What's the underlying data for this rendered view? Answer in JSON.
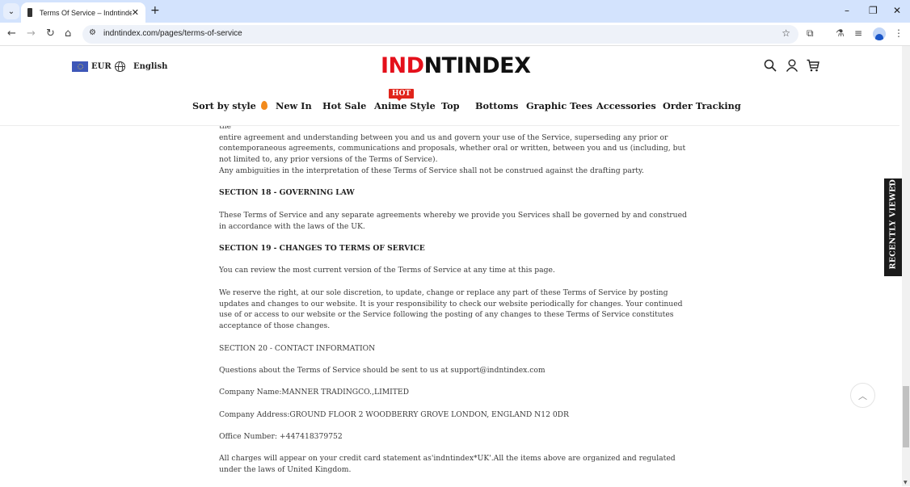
{
  "browser": {
    "tab_title": "Terms Of Service – Indntindex",
    "url": "indntindex.com/pages/terms-of-service",
    "icons": [
      "tab-search-icon",
      "back-icon",
      "forward-icon",
      "reload-icon",
      "home-icon",
      "site-settings-icon",
      "bookmark-star-icon",
      "extensions-icon",
      "labs-icon",
      "reading-list-icon",
      "profile-icon",
      "menu-icon"
    ]
  },
  "header": {
    "currency": "EUR",
    "language": "English",
    "logo_red": "IND",
    "logo_black": "NTINDEX",
    "hot_badge": "HOT",
    "nav": [
      {
        "label": "Sort by style"
      },
      {
        "label": "New In"
      },
      {
        "label": "Hot Sale"
      },
      {
        "label": "Anime Style"
      },
      {
        "label": "Top"
      },
      {
        "label": "Bottoms"
      },
      {
        "label": "Graphic Tees"
      },
      {
        "label": "Accessories"
      },
      {
        "label": "Order Tracking"
      }
    ]
  },
  "content": {
    "p0_clipped": "These Terms of Service and any policies or operating rules posted by us on this site or in respect to the Service constitutes the",
    "p0": "entire agreement and understanding between you and us and govern your use of the Service, superseding any prior or contemporaneous agreements, communications and proposals, whether oral or written, between you and us (including, but not limited to, any prior versions of the Terms of Service).",
    "p0b": "Any ambiguities in the interpretation of these Terms of Service shall not be construed against the drafting party.",
    "s18_title": "SECTION 18 - GOVERNING LAW",
    "s18_body": "These Terms of Service and any separate agreements whereby we provide you Services shall be governed by and construed in accordance with the laws of the UK.",
    "s19_title": "SECTION 19 - CHANGES TO TERMS OF SERVICE",
    "s19_p1": "You can review the most current version of the Terms of Service at any time at this page.",
    "s19_p2": "We reserve the right, at our sole discretion, to update, change or replace any part of these Terms of Service by posting updates and changes to our website. It is your responsibility to check our website periodically for changes. Your continued use of or access to our website or the Service following the posting of any changes to these Terms of Service constitutes acceptance of those changes.",
    "s20_title": "SECTION 20 - CONTACT INFORMATION",
    "s20_p1": "Questions about the Terms of Service should be sent to us at support@indntindex.com",
    "company_name": "Company Name:MANNER TRADINGCO.,LIMITED",
    "company_address": "Company Address:GROUND FLOOR 2 WOODBERRY GROVE LONDON, ENGLAND N12 0DR",
    "office_number": "Office Number:  +447418379752",
    "charges": "All charges will appear on your credit card statement as'indntindex*UK'.All the items above are organized and regulated under the laws of United Kingdom."
  },
  "widgets": {
    "recently_viewed": "RECENTLY VIEWED"
  },
  "colors": {
    "brand_red": "#e4101b",
    "hot_badge": "#e0241b",
    "flame": "#f28a1c"
  }
}
